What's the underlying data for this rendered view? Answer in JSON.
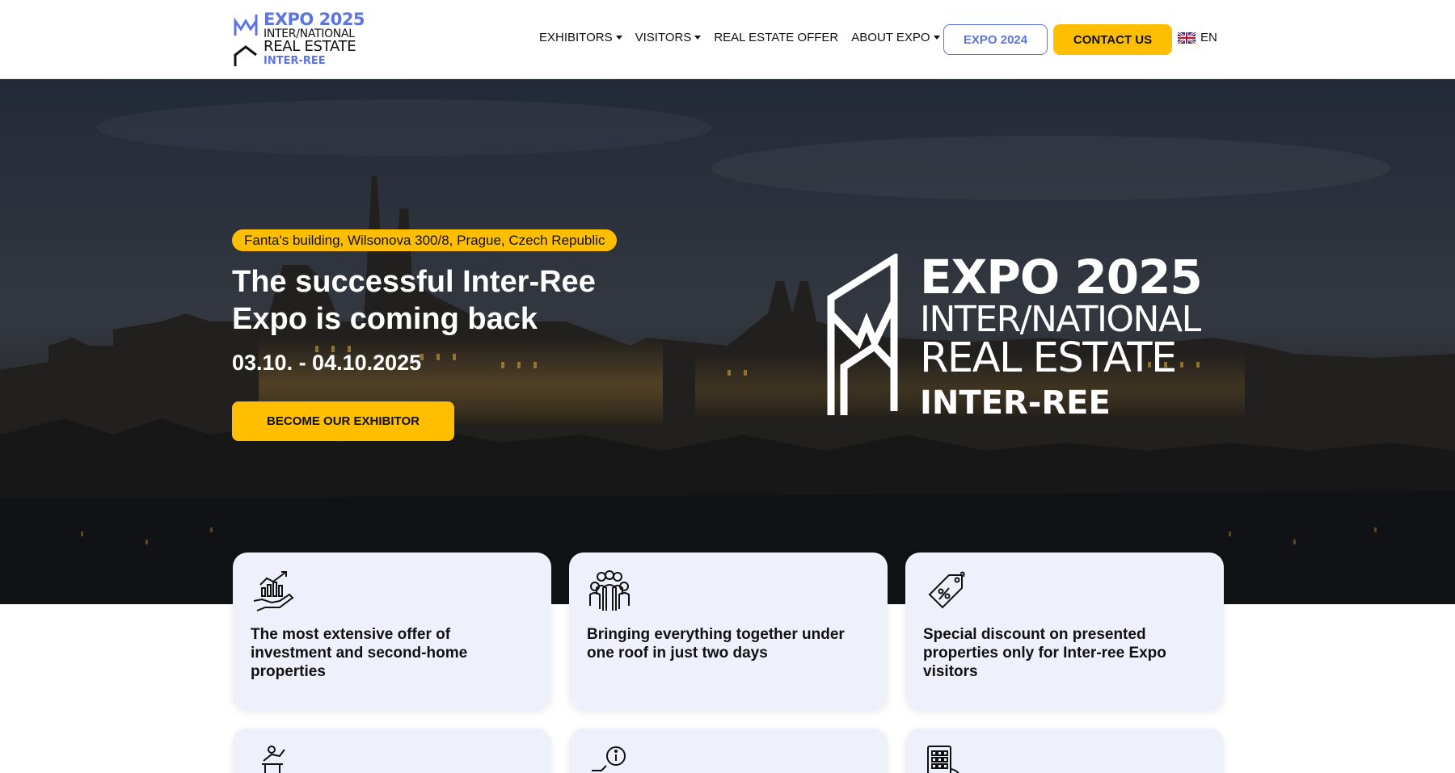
{
  "header": {
    "logo": {
      "line1": "EXPO 2025",
      "line2": "INTER/NATIONAL",
      "line3": "REAL ESTATE",
      "line4": "INTER-REE"
    },
    "nav": [
      {
        "label": "EXHIBITORS",
        "dropdown": true
      },
      {
        "label": "VISITORS",
        "dropdown": true
      },
      {
        "label": "REAL ESTATE OFFER",
        "dropdown": false
      },
      {
        "label": "ABOUT EXPO",
        "dropdown": true
      }
    ],
    "expo_prev_button": "EXPO 2024",
    "contact_button": "CONTACT US",
    "language": "EN"
  },
  "hero": {
    "location": "Fanta's building, Wilsonova 300/8, Prague, Czech Republic",
    "title": "The successful Inter-Ree Expo is coming back",
    "dates": "03.10. - 04.10.2025",
    "cta": "BECOME OUR EXHIBITOR",
    "big_logo": {
      "line1": "EXPO 2025",
      "line2": "INTER/NATIONAL",
      "line3": "REAL ESTATE",
      "line4": "INTER-REE"
    }
  },
  "features": [
    {
      "icon": "investment-growth-icon",
      "text": "The most extensive offer of investment and second-home properties"
    },
    {
      "icon": "people-group-icon",
      "text": "Bringing everything together under one roof in just two days"
    },
    {
      "icon": "discount-tag-icon",
      "text": "Special discount on presented properties only for Inter-ree Expo visitors"
    },
    {
      "icon": "speaker-podium-icon",
      "text": ""
    },
    {
      "icon": "info-person-icon",
      "text": ""
    },
    {
      "icon": "building-icon",
      "text": ""
    }
  ],
  "colors": {
    "accent_blue": "#5b74e0",
    "accent_yellow": "#ffbf00",
    "card_bg": "#eef0fb"
  }
}
